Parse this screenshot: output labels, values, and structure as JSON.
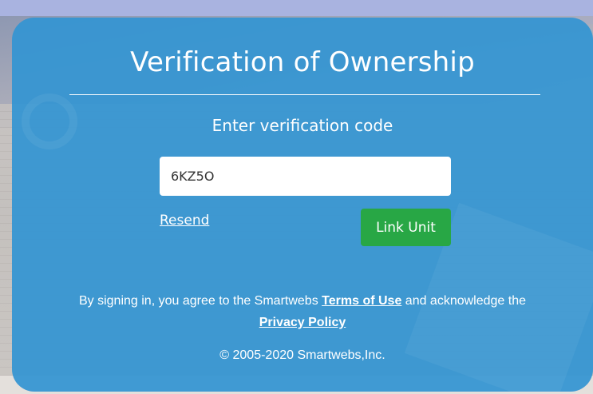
{
  "card": {
    "title": "Verification of Ownership",
    "subtitle": "Enter verification code"
  },
  "form": {
    "code_value": "6KZ5O",
    "resend_label": "Resend",
    "submit_label": "Link Unit"
  },
  "footer": {
    "agree_prefix": "By signing in, you agree to the Smartwebs ",
    "terms_label": "Terms of Use",
    "agree_middle": " and acknowledge the",
    "privacy_label": "Privacy Policy",
    "copyright": "© 2005-2020 Smartwebs,Inc."
  },
  "colors": {
    "card_bg": "#3494d2",
    "button_bg": "#28a745"
  }
}
